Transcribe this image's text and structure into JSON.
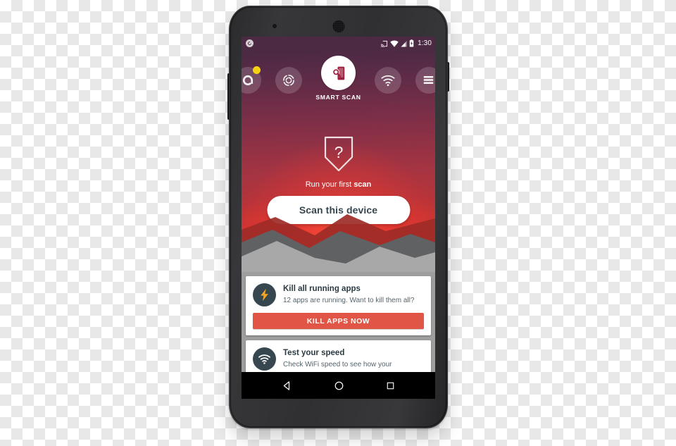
{
  "device": {
    "frame": "nexus-phone",
    "body_color": "#303032"
  },
  "statusbar": {
    "app_icon": "avast-logo-icon",
    "icons": [
      "cast-icon",
      "wifi-icon",
      "signal-icon",
      "battery-charging-icon"
    ],
    "time": "1:30"
  },
  "nav": {
    "items": [
      {
        "id": "avast-home",
        "icon": "avast-logo-icon",
        "label": "",
        "badge": true,
        "active": false
      },
      {
        "id": "cleanup",
        "icon": "cleanup-spiral-icon",
        "label": "",
        "badge": false,
        "active": false
      },
      {
        "id": "smart-scan",
        "icon": "device-scan-icon",
        "label": "SMART SCAN",
        "badge": false,
        "active": true
      },
      {
        "id": "wifi-security",
        "icon": "wifi-icon",
        "label": "",
        "badge": false,
        "active": false
      },
      {
        "id": "menu",
        "icon": "hamburger-menu-icon",
        "label": "",
        "badge": false,
        "active": false
      }
    ],
    "active_label": "SMART SCAN"
  },
  "hero": {
    "shield_icon": "shield-question-icon",
    "subtitle_prefix": "Run your first ",
    "subtitle_strong": "scan",
    "scan_button": "Scan this device",
    "colors": {
      "gradient_top": "#4a2a44",
      "gradient_bottom": "#cf3332",
      "glow": "#ef3a38"
    }
  },
  "cards": [
    {
      "id": "kill-apps",
      "icon": "lightning-bolt-icon",
      "icon_color": "#f5a623",
      "title": "Kill all running apps",
      "description": "12 apps are running. Want to kill them all?",
      "action_label": "KILL APPS NOW",
      "action_color": "#e05546"
    },
    {
      "id": "test-speed",
      "icon": "wifi-icon",
      "icon_color": "#ffffff",
      "title": "Test your speed",
      "description": "Check WiFi speed to see how your",
      "action_label": "",
      "action_color": ""
    }
  ],
  "android_navbar": {
    "back": "back-triangle-icon",
    "home": "home-circle-icon",
    "recents": "recents-square-icon"
  }
}
